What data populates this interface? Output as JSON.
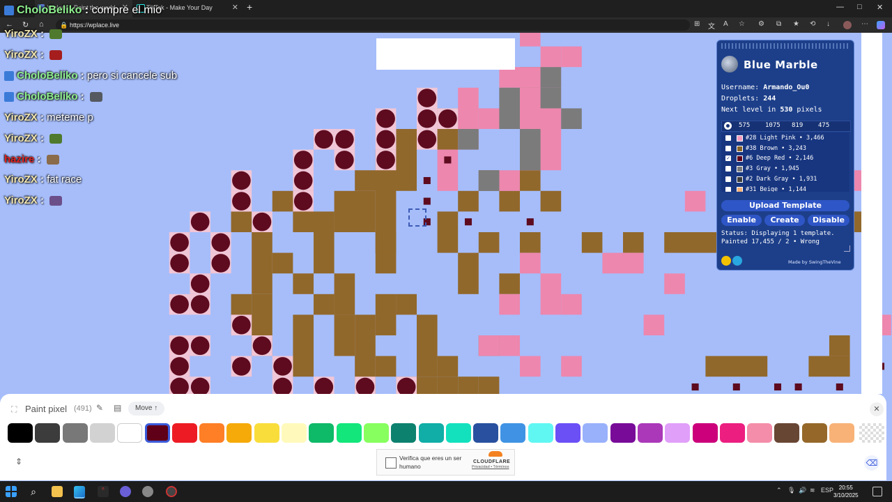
{
  "browser": {
    "tabs": [
      {
        "label": "Wplace - Paint the world",
        "active": true
      },
      {
        "label": "TikTok - Make Your Day",
        "active": false
      }
    ],
    "url": "https://wplace.live",
    "window_controls": {
      "minimize": "—",
      "maximize": "□",
      "close": "✕"
    }
  },
  "chat": [
    {
      "user": "YiroZX",
      "text": "",
      "emote": "#4f7a2d",
      "style": "yiro"
    },
    {
      "user": "YiroZX",
      "text": "",
      "emote": "#a51d1d",
      "style": "yiro"
    },
    {
      "user": "CholoBeliko",
      "text": "pero si cancele sub",
      "emote": "",
      "style": "cholo"
    },
    {
      "user": "CholoBeliko",
      "text": "",
      "emote": "#555a60",
      "style": "cholo"
    },
    {
      "user": "YiroZX",
      "text": "meteme p",
      "emote": "",
      "style": "yiro"
    },
    {
      "user": "YiroZX",
      "text": "",
      "emote": "#4f7a2d",
      "style": "yiro"
    },
    {
      "user": "hazire",
      "text": "",
      "emote": "#8a6b4a",
      "style": "hazire"
    },
    {
      "user": "YiroZX",
      "text": "fat race",
      "emote": "",
      "style": "yiro"
    },
    {
      "user": "YiroZX",
      "text": "",
      "emote": "#6b4f8a",
      "style": "yiro"
    }
  ],
  "chat_top": {
    "user": "CholoBeliko",
    "text": "compre el mio"
  },
  "blue_marble": {
    "title": "Blue Marble",
    "username_label": "Username:",
    "username": "Armando_Ou0",
    "droplets_label": "Droplets:",
    "droplets": "244",
    "next_level_prefix": "Next level in",
    "next_level_pixels": "530",
    "next_level_suffix": "pixels",
    "coords": [
      "575",
      "1075",
      "819",
      "475"
    ],
    "colors": [
      {
        "label": "#28 Light Pink • 3,466",
        "swatch": "#f49bbd",
        "checked": false
      },
      {
        "label": "#38 Brown • 3,243",
        "swatch": "#8a6328",
        "checked": false
      },
      {
        "label": "#6 Deep Red • 2,146",
        "swatch": "#600018",
        "checked": true
      },
      {
        "label": "#3 Gray • 1,945",
        "swatch": "#787878",
        "checked": false
      },
      {
        "label": "#2 Dark Gray • 1,931",
        "swatch": "#3c3c3c",
        "checked": false
      },
      {
        "label": "#31 Beige • 1,144",
        "swatch": "#f8b277",
        "checked": false
      }
    ],
    "upload_label": "Upload Template",
    "enable_label": "Enable",
    "create_label": "Create",
    "disable_label": "Disable",
    "status_text": "Status: Displaying 1 template.",
    "painted_text": "Painted 17,455 / 2 • Wrong",
    "made_by": "Made by SwingTheVine"
  },
  "paint": {
    "title": "Paint pixel",
    "count": "(491)",
    "move_label": "Move ↑",
    "close_icon": "✕",
    "palette": [
      "#000000",
      "#3c3c3c",
      "#787878",
      "#d2d2d2",
      "#ffffff",
      "#600018",
      "#ed1c24",
      "#ff7f27",
      "#f6aa09",
      "#f9dd3b",
      "#fffabc",
      "#0eb968",
      "#13e67b",
      "#87ff5e",
      "#0c816e",
      "#10aea6",
      "#13e1be",
      "#28509e",
      "#4093e4",
      "#60f7f2",
      "#6b50f6",
      "#99b1fb",
      "#780c99",
      "#aa38b9",
      "#e09ff9",
      "#cb007a",
      "#ec1f80",
      "#f38da9",
      "#684634",
      "#95682a",
      "#f8b277"
    ],
    "selected_index": 5,
    "captcha_text": "Verifica que eres un ser humano",
    "captcha_brand": "CLOUDFLARE",
    "captcha_links": "Privacidad • Términos"
  },
  "taskbar": {
    "lang": "ESP",
    "time": "20:55",
    "date": "3/10/2025"
  },
  "canvas": {
    "background": "#a6bdfa",
    "color_brown": "#91682b",
    "color_pink": "#ed87ae",
    "color_gray": "#7b7b7b",
    "color_deepred": "#5e0b1f"
  }
}
